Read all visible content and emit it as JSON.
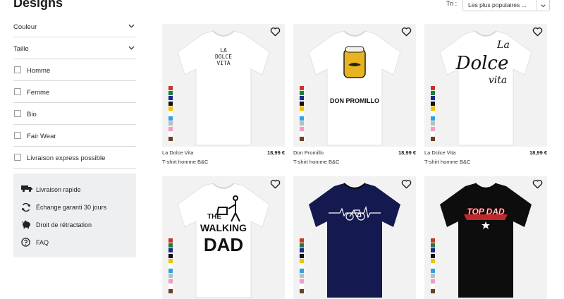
{
  "header": {
    "title": "Designs",
    "sort_label": "Tri :",
    "sort_value": "Les plus populaires ..."
  },
  "filters": {
    "dropdowns": [
      {
        "label": "Couleur"
      },
      {
        "label": "Taille"
      }
    ],
    "checkboxes": [
      {
        "label": "Homme",
        "checked": false
      },
      {
        "label": "Femme",
        "checked": false
      },
      {
        "label": "Bio",
        "checked": false
      },
      {
        "label": "Fair Wear",
        "checked": false
      },
      {
        "label": "Livraison express possible",
        "checked": false
      }
    ]
  },
  "info": {
    "items": [
      {
        "label": "Livraison rapide",
        "icon": "truck-icon"
      },
      {
        "label": "Échange garanti 30 jours",
        "icon": "exchange-icon"
      },
      {
        "label": "Droit de rétractation",
        "icon": "piggy-bank-icon"
      },
      {
        "label": "FAQ",
        "icon": "question-icon"
      }
    ]
  },
  "swatch_colors": [
    "#c0392b",
    "#1e7d3a",
    "#1a2a8c",
    "#111111",
    "#f2c200",
    "#ffffff",
    "#2fa4e0",
    "#bdbdbd",
    "#f29bc7",
    "#ffffff",
    "#6b3f22"
  ],
  "products": [
    {
      "name": "La Dolce Vita",
      "price": "18,99 €",
      "type": "T-shirt homme B&C",
      "shirt_color": "#ffffff",
      "design_text": [
        "LA",
        "DOLCE",
        "VITA"
      ]
    },
    {
      "name": "Don Promillo",
      "price": "18,99 €",
      "type": "T-shirt homme B&C",
      "shirt_color": "#ffffff",
      "design_text": [
        "DON PROMILLO"
      ]
    },
    {
      "name": "La Dolce Vita",
      "price": "18,99 €",
      "type": "T-shirt homme B&C",
      "shirt_color": "#ffffff",
      "design_text": [
        "La",
        "Dolce",
        "vita"
      ]
    },
    {
      "name": "",
      "price": "",
      "type": "",
      "shirt_color": "#ffffff",
      "design_text": [
        "THE",
        "WALKING",
        "DAD"
      ]
    },
    {
      "name": "",
      "price": "",
      "type": "",
      "shirt_color": "#14194f",
      "design_text": []
    },
    {
      "name": "",
      "price": "",
      "type": "",
      "shirt_color": "#0d0d0d",
      "design_text": [
        "TOP DAD"
      ]
    }
  ]
}
